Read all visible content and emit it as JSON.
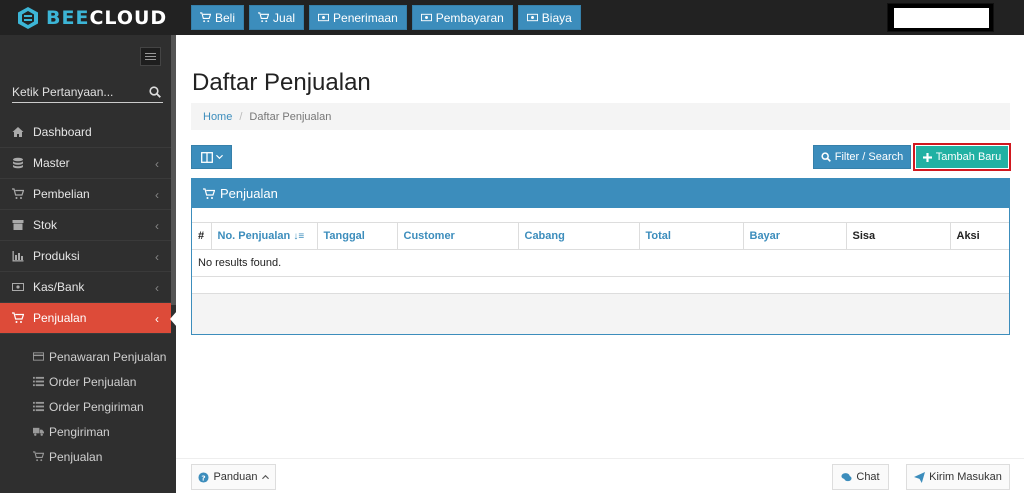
{
  "app": {
    "logo_text_a": "BEE",
    "logo_text_b": "CLOUD",
    "brand_color": "#3cb5d6"
  },
  "topnav": [
    {
      "label": "Beli",
      "icon": "cart-icon"
    },
    {
      "label": "Jual",
      "icon": "cart-icon"
    },
    {
      "label": "Penerimaan",
      "icon": "money-icon"
    },
    {
      "label": "Pembayaran",
      "icon": "money-icon"
    },
    {
      "label": "Biaya",
      "icon": "money-icon"
    }
  ],
  "sidebar": {
    "search_placeholder": "Ketik Pertanyaan...",
    "items": [
      {
        "label": "Dashboard",
        "icon": "home-icon",
        "has_children": false
      },
      {
        "label": "Master",
        "icon": "database-icon",
        "has_children": true
      },
      {
        "label": "Pembelian",
        "icon": "cart-icon",
        "has_children": true
      },
      {
        "label": "Stok",
        "icon": "box-icon",
        "has_children": true
      },
      {
        "label": "Produksi",
        "icon": "chart-icon",
        "has_children": true
      },
      {
        "label": "Kas/Bank",
        "icon": "money-icon",
        "has_children": true
      },
      {
        "label": "Penjualan",
        "icon": "cart-icon",
        "has_children": true,
        "active": true
      }
    ],
    "submenu": [
      {
        "label": "Penawaran Penjualan",
        "icon": "card-icon"
      },
      {
        "label": "Order Penjualan",
        "icon": "list-icon"
      },
      {
        "label": "Order Pengiriman",
        "icon": "list-icon"
      },
      {
        "label": "Pengiriman",
        "icon": "truck-icon"
      },
      {
        "label": "Penjualan",
        "icon": "cart-icon"
      }
    ]
  },
  "main": {
    "title": "Daftar Penjualan",
    "breadcrumb": {
      "home": "Home",
      "current": "Daftar Penjualan"
    },
    "filter_label": "Filter / Search",
    "add_label": "Tambah Baru",
    "panel_title": "Penjualan",
    "table": {
      "columns": [
        "#",
        "No. Penjualan",
        "Tanggal",
        "Customer",
        "Cabang",
        "Total",
        "Bayar",
        "Sisa",
        "Aksi"
      ],
      "empty_text": "No results found."
    }
  },
  "bottom": {
    "guide_label": "Panduan",
    "chat_label": "Chat",
    "feedback_label": "Kirim Masukan"
  }
}
